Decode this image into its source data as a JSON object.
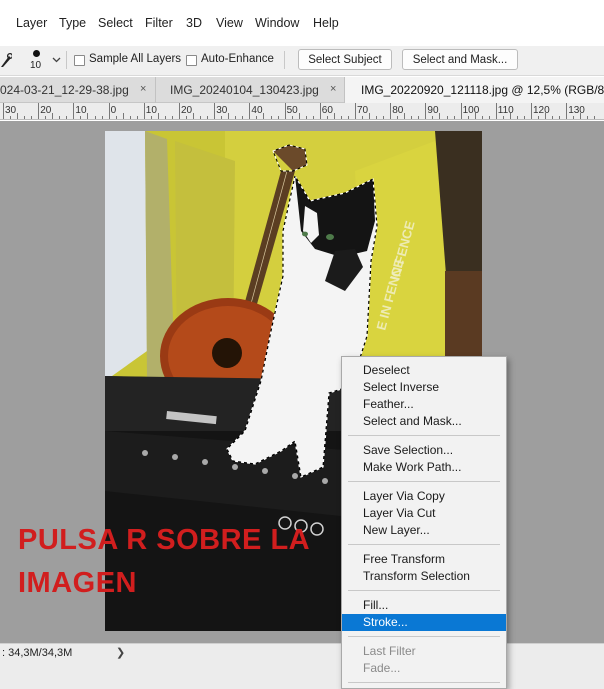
{
  "menubar": {
    "items": [
      "Layer",
      "Type",
      "Select",
      "Filter",
      "3D",
      "View",
      "Window",
      "Help"
    ]
  },
  "options": {
    "brush_size": "10",
    "sample_all_layers_label": "Sample All Layers",
    "auto_enhance_label": "Auto-Enhance",
    "select_subject_label": "Select Subject",
    "select_and_mask_label": "Select and Mask..."
  },
  "tabs": [
    {
      "label": "024-03-21_12-29-38.jpg",
      "close": "×"
    },
    {
      "label": "IMG_20240104_130423.jpg",
      "close": "×"
    },
    {
      "label": "IMG_20220920_121118.jpg @ 12,5% (RGB/8"
    }
  ],
  "ruler": {
    "labels": [
      "30",
      "20",
      "10",
      "0",
      "10",
      "20",
      "30",
      "40",
      "50",
      "60",
      "70",
      "80",
      "90",
      "100",
      "110",
      "120",
      "130"
    ]
  },
  "canvas": {
    "overlay_line1": "PULSA R SOBRE LA",
    "overlay_line2": "IMAGEN",
    "shirt_text_1": "IN FENCE",
    "shirt_text_2": "E IN FENCE"
  },
  "status": {
    "doc_size": ": 34,3M/34,3M",
    "arrow": "❯"
  },
  "context_menu": {
    "groups": [
      [
        "Deselect",
        "Select Inverse",
        "Feather...",
        "Select and Mask..."
      ],
      [
        "Save Selection...",
        "Make Work Path..."
      ],
      [
        "Layer Via Copy",
        "Layer Via Cut",
        "New Layer..."
      ],
      [
        "Free Transform",
        "Transform Selection"
      ],
      [
        "Fill...",
        "Stroke..."
      ],
      [
        "Last Filter",
        "Fade..."
      ]
    ],
    "active_item": "Stroke...",
    "accent": "#0a78d4"
  },
  "colors": {
    "overlay_text": "#d11e1e",
    "workarea": "#9e9e9e"
  }
}
